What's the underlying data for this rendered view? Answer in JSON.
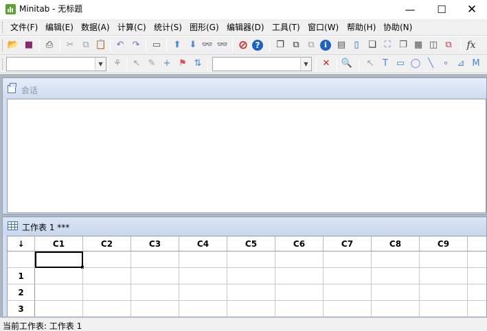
{
  "window": {
    "title": "Minitab - 无标题",
    "min_glyph": "—",
    "max_glyph": "☐",
    "close_glyph": "✕"
  },
  "menu": [
    {
      "name": "menu-file",
      "label": "文件(F)"
    },
    {
      "name": "menu-edit",
      "label": "编辑(E)"
    },
    {
      "name": "menu-data",
      "label": "数据(A)"
    },
    {
      "name": "menu-calc",
      "label": "计算(C)"
    },
    {
      "name": "menu-stat",
      "label": "统计(S)"
    },
    {
      "name": "menu-graph",
      "label": "图形(G)"
    },
    {
      "name": "menu-editor",
      "label": "编辑器(D)"
    },
    {
      "name": "menu-tools",
      "label": "工具(T)"
    },
    {
      "name": "menu-window",
      "label": "窗口(W)"
    },
    {
      "name": "menu-help",
      "label": "帮助(H)"
    },
    {
      "name": "menu-assist",
      "label": "协助(N)"
    }
  ],
  "toolbar1": [
    {
      "icon": "open-folder-icon",
      "glyph": "📂",
      "color": "#e0a800"
    },
    {
      "icon": "save-icon",
      "glyph": "■",
      "color": "#8a2a6e"
    },
    {
      "icon": "print-icon",
      "glyph": "⎙",
      "color": "#333333"
    },
    {
      "icon": "cut-icon",
      "glyph": "✂",
      "color": "#a0a0a0"
    },
    {
      "icon": "copy-icon",
      "glyph": "⧉",
      "color": "#a0a0a0"
    },
    {
      "icon": "paste-icon",
      "glyph": "📋",
      "color": "#a0a0a0"
    },
    {
      "icon": "undo-icon",
      "glyph": "↶",
      "color": "#5a7fb8"
    },
    {
      "icon": "redo-icon",
      "glyph": "↷",
      "color": "#5a7fb8"
    },
    {
      "icon": "window-icon",
      "glyph": "▭",
      "color": "#555555"
    },
    {
      "icon": "arrow-up-icon",
      "glyph": "⬆",
      "color": "#4a86d0"
    },
    {
      "icon": "arrow-down-icon",
      "glyph": "⬇",
      "color": "#4a86d0"
    },
    {
      "icon": "find-icon",
      "glyph": "👓",
      "color": "#333333"
    },
    {
      "icon": "replace-icon",
      "glyph": "👓",
      "color": "#a0a0a0"
    },
    {
      "icon": "cancel-icon",
      "glyph": "⊘",
      "color": "#d42020"
    },
    {
      "icon": "help-icon",
      "glyph": "?",
      "color": "#1e63c0"
    },
    {
      "icon": "session-icon",
      "glyph": "❐",
      "color": "#333333"
    },
    {
      "icon": "worksheets-icon",
      "glyph": "⧉",
      "color": "#333333"
    },
    {
      "icon": "graphs-icon",
      "glyph": "⧉",
      "color": "#a0a0a0"
    },
    {
      "icon": "info-icon",
      "glyph": "ℹ",
      "color": "#1e63c0"
    },
    {
      "icon": "history-icon",
      "glyph": "▤",
      "color": "#555555"
    },
    {
      "icon": "notes-icon",
      "glyph": "▯",
      "color": "#1e63c0"
    },
    {
      "icon": "new-doc-icon",
      "glyph": "❏",
      "color": "#333333"
    },
    {
      "icon": "layout-icon",
      "glyph": "⛶",
      "color": "#4a86d0"
    },
    {
      "icon": "report-icon",
      "glyph": "❐",
      "color": "#555555"
    },
    {
      "icon": "grid-icon",
      "glyph": "▦",
      "color": "#555555"
    },
    {
      "icon": "panel-icon",
      "glyph": "◫",
      "color": "#555555"
    },
    {
      "icon": "close-window-icon",
      "glyph": "⧉",
      "color": "#c04040"
    },
    {
      "icon": "function-icon",
      "glyph": "fx",
      "color": "#333333"
    }
  ],
  "toolbar2": [
    {
      "icon": "brush-icon",
      "glyph": "⚘",
      "color": "#a0a0a0"
    },
    {
      "icon": "pointer-icon",
      "glyph": "↖",
      "color": "#a0a0a0"
    },
    {
      "icon": "brush-pen-icon",
      "glyph": "✎",
      "color": "#a0a0a0"
    },
    {
      "icon": "crosshair-icon",
      "glyph": "+",
      "color": "#4a86d0"
    },
    {
      "icon": "flag-icon",
      "glyph": "⚑",
      "color": "#e05050"
    },
    {
      "icon": "swap-icon",
      "glyph": "⇅",
      "color": "#4a86d0"
    },
    {
      "icon": "delete-icon",
      "glyph": "✕",
      "color": "#d42020"
    },
    {
      "icon": "zoom-icon",
      "glyph": "🔍",
      "color": "#a0a0a0"
    },
    {
      "icon": "select-arrow-icon",
      "glyph": "↖",
      "color": "#a0a0a0"
    },
    {
      "icon": "text-tool-icon",
      "glyph": "T",
      "color": "#4a86d0"
    },
    {
      "icon": "rectangle-tool-icon",
      "glyph": "▭",
      "color": "#4a86d0"
    },
    {
      "icon": "ellipse-tool-icon",
      "glyph": "◯",
      "color": "#4a86d0"
    },
    {
      "icon": "line-tool-icon",
      "glyph": "╲",
      "color": "#4a86d0"
    },
    {
      "icon": "marker-tool-icon",
      "glyph": "∘",
      "color": "#4a86d0"
    },
    {
      "icon": "polyline-tool-icon",
      "glyph": "⊿",
      "color": "#4a86d0"
    },
    {
      "icon": "polygon-tool-icon",
      "glyph": "M",
      "color": "#4a86d0"
    }
  ],
  "session": {
    "title": "会话"
  },
  "worksheet": {
    "title": "工作表 1 ***",
    "corner": "↓",
    "columns": [
      "C1",
      "C2",
      "C3",
      "C4",
      "C5",
      "C6",
      "C7",
      "C8",
      "C9",
      "C"
    ],
    "rows": [
      "1",
      "2",
      "3"
    ]
  },
  "status": {
    "text": "当前工作表: 工作表 1"
  }
}
